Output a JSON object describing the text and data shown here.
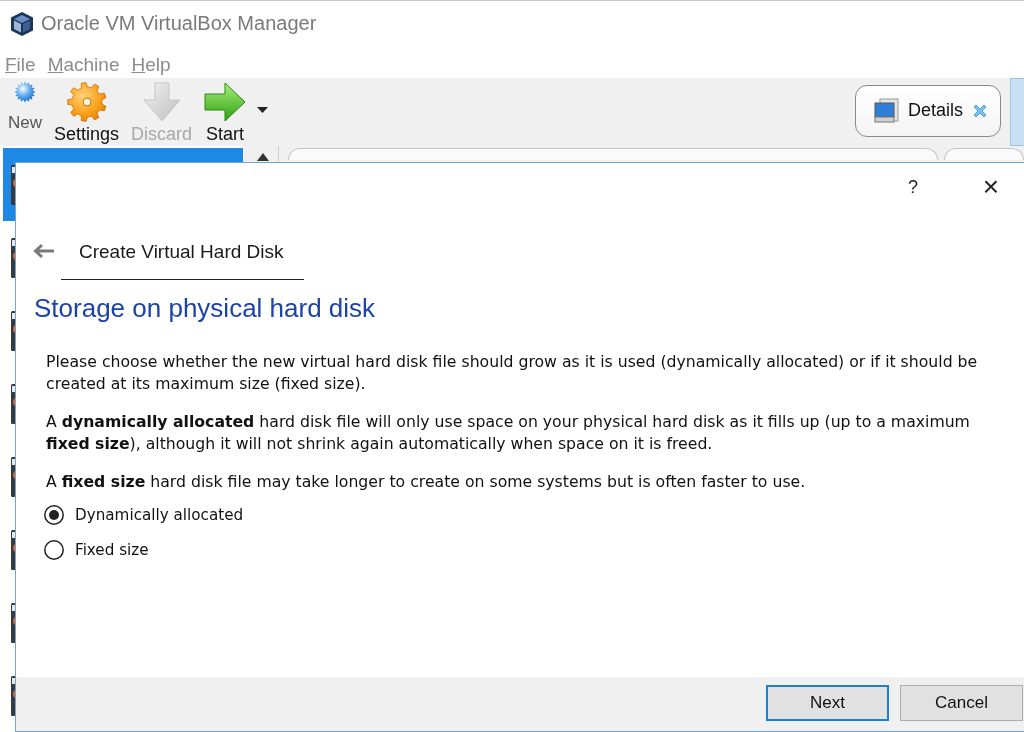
{
  "window": {
    "title": "Oracle VM VirtualBox Manager"
  },
  "menu": [
    {
      "label": "File"
    },
    {
      "label": "Machine"
    },
    {
      "label": "Help"
    }
  ],
  "toolbar": {
    "items": [
      {
        "kind": "new",
        "label": "New",
        "disabled": false,
        "dropdown": false
      },
      {
        "kind": "settings",
        "label": "Settings",
        "disabled": false,
        "dropdown": false
      },
      {
        "kind": "discard",
        "label": "Discard",
        "disabled": true,
        "dropdown": false
      },
      {
        "kind": "start",
        "label": "Start",
        "disabled": false,
        "dropdown": true
      }
    ]
  },
  "tools": {
    "details": {
      "label": "Details"
    }
  },
  "vm_list": {
    "items": [
      {
        "selected": true
      },
      {
        "selected": false
      },
      {
        "selected": false
      },
      {
        "selected": false
      },
      {
        "selected": false
      },
      {
        "selected": false
      },
      {
        "selected": false
      },
      {
        "selected": false
      }
    ]
  },
  "dialog": {
    "title_buttons": {
      "help": "?",
      "close": "×"
    },
    "title": "Create Virtual Hard Disk",
    "heading": "Storage on physical hard disk",
    "paragraphs": [
      "Please choose whether the new virtual hard disk file should grow as it is used (dynamically allocated) or if it should be created at its maximum size (fixed size).",
      "A **dynamically allocated** hard disk file will only use space on your physical hard disk as it fills up (up to a maximum **fixed size**), although it will not shrink again automatically when space on it is freed.",
      "A **fixed size** hard disk file may take longer to create on some systems but is often faster to use."
    ],
    "options": [
      {
        "label": "Dynamically allocated",
        "selected": true
      },
      {
        "label": "Fixed size",
        "selected": false
      }
    ],
    "buttons": [
      {
        "label": "Next",
        "default": true
      },
      {
        "label": "Cancel",
        "default": false
      }
    ]
  }
}
